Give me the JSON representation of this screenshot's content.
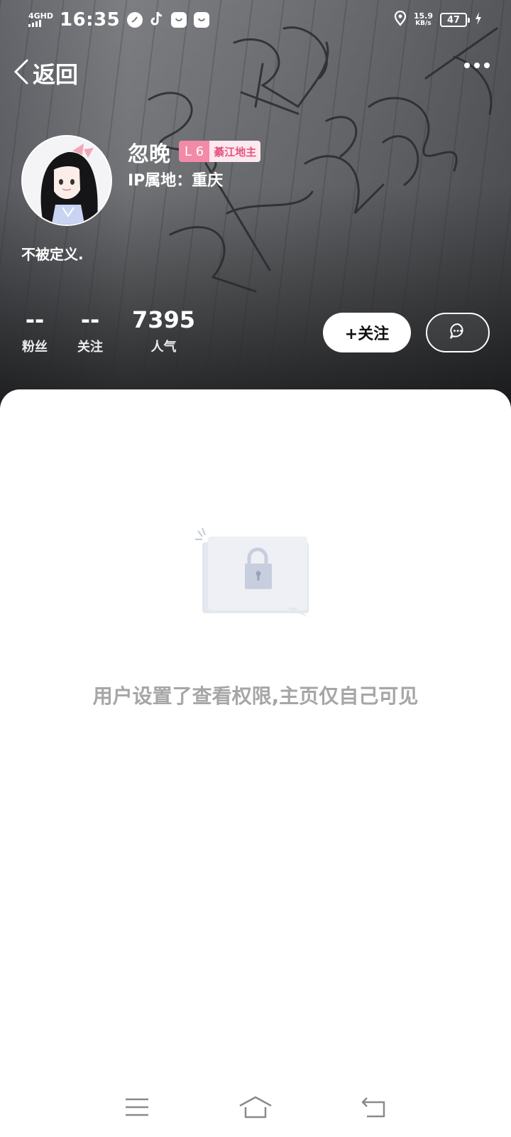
{
  "status_bar": {
    "network": "4GHD",
    "time": "16:35",
    "net_speed_value": "15.9",
    "net_speed_unit": "KB/s",
    "battery": "47"
  },
  "nav": {
    "back_label": "返回"
  },
  "profile": {
    "nickname": "忽晚",
    "level_badge": "L 6",
    "title_badge": "綦江地主",
    "ip_location": "IP属地：重庆",
    "bio": "不被定义."
  },
  "stats": [
    {
      "value": "--",
      "label": "粉丝"
    },
    {
      "value": "--",
      "label": "关注"
    },
    {
      "value": "7395",
      "label": "人气"
    }
  ],
  "actions": {
    "follow_label": "+关注"
  },
  "content": {
    "private_notice": "用户设置了查看权限,主页仅自己可见"
  },
  "colors": {
    "badge_level_bg": "#f28aa8",
    "badge_title_text": "#e3547f",
    "notice_text": "#a6a6a6"
  }
}
